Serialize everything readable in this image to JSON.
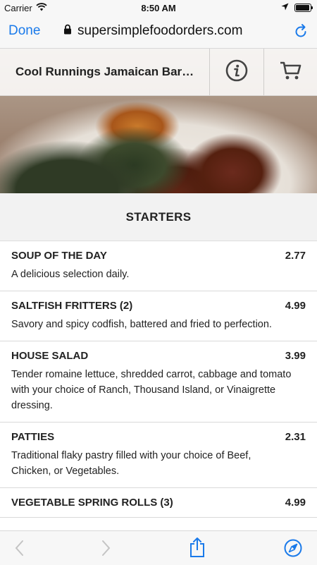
{
  "status_bar": {
    "carrier": "Carrier",
    "time": "8:50 AM"
  },
  "browser": {
    "done_label": "Done",
    "url": "supersimplefoodorders.com"
  },
  "restaurant": {
    "name": "Cool Runnings Jamaican Bar & Grill"
  },
  "section": {
    "title": "STARTERS"
  },
  "menu": {
    "items": [
      {
        "name": "SOUP OF THE DAY",
        "price": "2.77",
        "description": "A delicious selection daily."
      },
      {
        "name": "SALTFISH FRITTERS (2)",
        "price": "4.99",
        "description": "Savory and spicy codfish, battered and fried to perfection."
      },
      {
        "name": "HOUSE SALAD",
        "price": "3.99",
        "description": "Tender romaine lettuce, shredded carrot, cabbage and tomato with your choice of Ranch, Thousand Island, or Vinaigrette dressing."
      },
      {
        "name": "PATTIES",
        "price": "2.31",
        "description": "Traditional flaky pastry filled with your choice of Beef, Chicken, or Vegetables."
      },
      {
        "name": "VEGETABLE SPRING ROLLS (3)",
        "price": "4.99",
        "description": ""
      }
    ]
  },
  "colors": {
    "accent": "#1a7aea",
    "icon_gray": "#444444",
    "disabled_gray": "#c4c4c4"
  },
  "icons": [
    "wifi-icon",
    "location-arrow-icon",
    "battery-icon",
    "lock-icon",
    "reload-icon",
    "info-icon",
    "cart-icon",
    "back-icon",
    "forward-icon",
    "share-icon",
    "compass-icon"
  ]
}
